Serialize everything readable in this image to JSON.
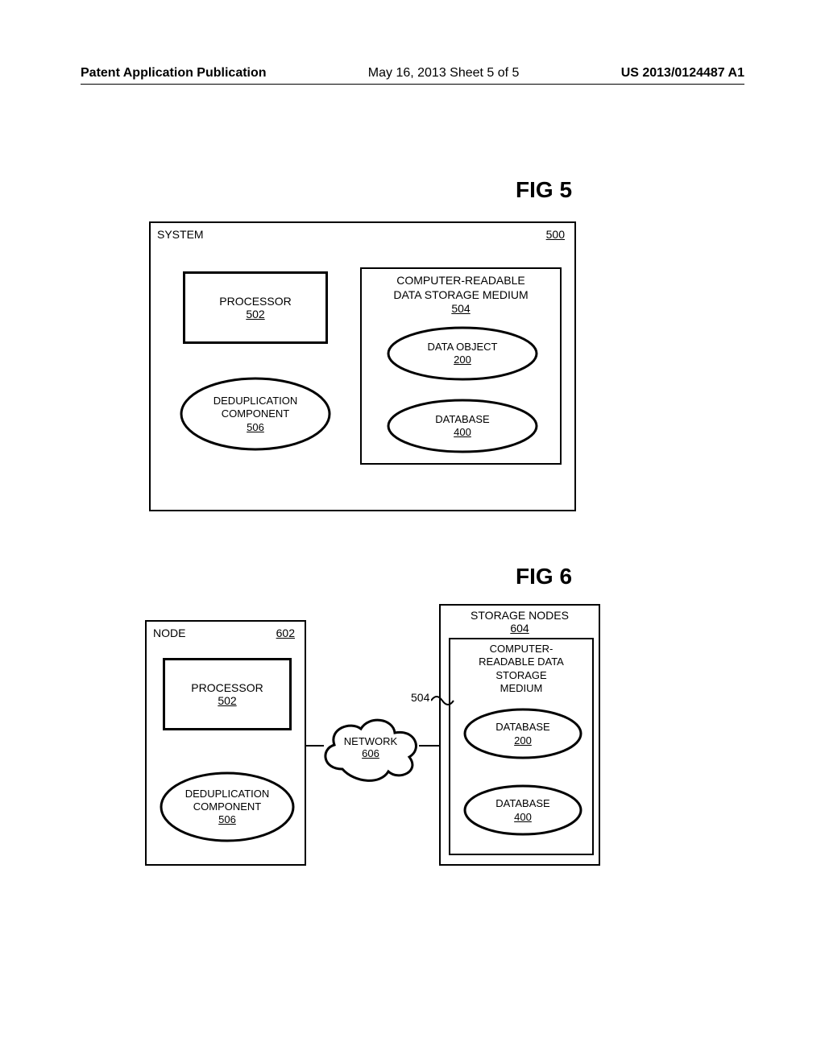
{
  "header": {
    "left": "Patent Application Publication",
    "mid": "May 16, 2013   Sheet 5 of 5",
    "right": "US 2013/0124487 A1"
  },
  "fig5": {
    "label": "FIG 5",
    "system_title": "SYSTEM",
    "system_ref": "500",
    "processor": {
      "label": "PROCESSOR",
      "ref": "502"
    },
    "dedup": {
      "line1": "DEDUPLICATION",
      "line2": "COMPONENT",
      "ref": "506"
    },
    "storage_title_l1": "COMPUTER-READABLE",
    "storage_title_l2": "DATA STORAGE MEDIUM",
    "storage_ref": "504",
    "data_object": {
      "label": "DATA OBJECT",
      "ref": "200"
    },
    "database": {
      "label": "DATABASE",
      "ref": "400"
    }
  },
  "fig6": {
    "label": "FIG 6",
    "node_title": "NODE",
    "node_ref": "602",
    "processor": {
      "label": "PROCESSOR",
      "ref": "502"
    },
    "dedup": {
      "line1": "DEDUPLICATION",
      "line2": "COMPONENT",
      "ref": "506"
    },
    "storage_nodes_title": "STORAGE NODES",
    "storage_nodes_ref": "604",
    "crdm_l1": "COMPUTER-",
    "crdm_l2": "READABLE DATA",
    "crdm_l3": "STORAGE",
    "crdm_l4": "MEDIUM",
    "crdm_callout_ref": "504",
    "db1": {
      "label": "DATABASE",
      "ref": "200"
    },
    "db2": {
      "label": "DATABASE",
      "ref": "400"
    },
    "network": {
      "label": "NETWORK",
      "ref": "606"
    }
  }
}
